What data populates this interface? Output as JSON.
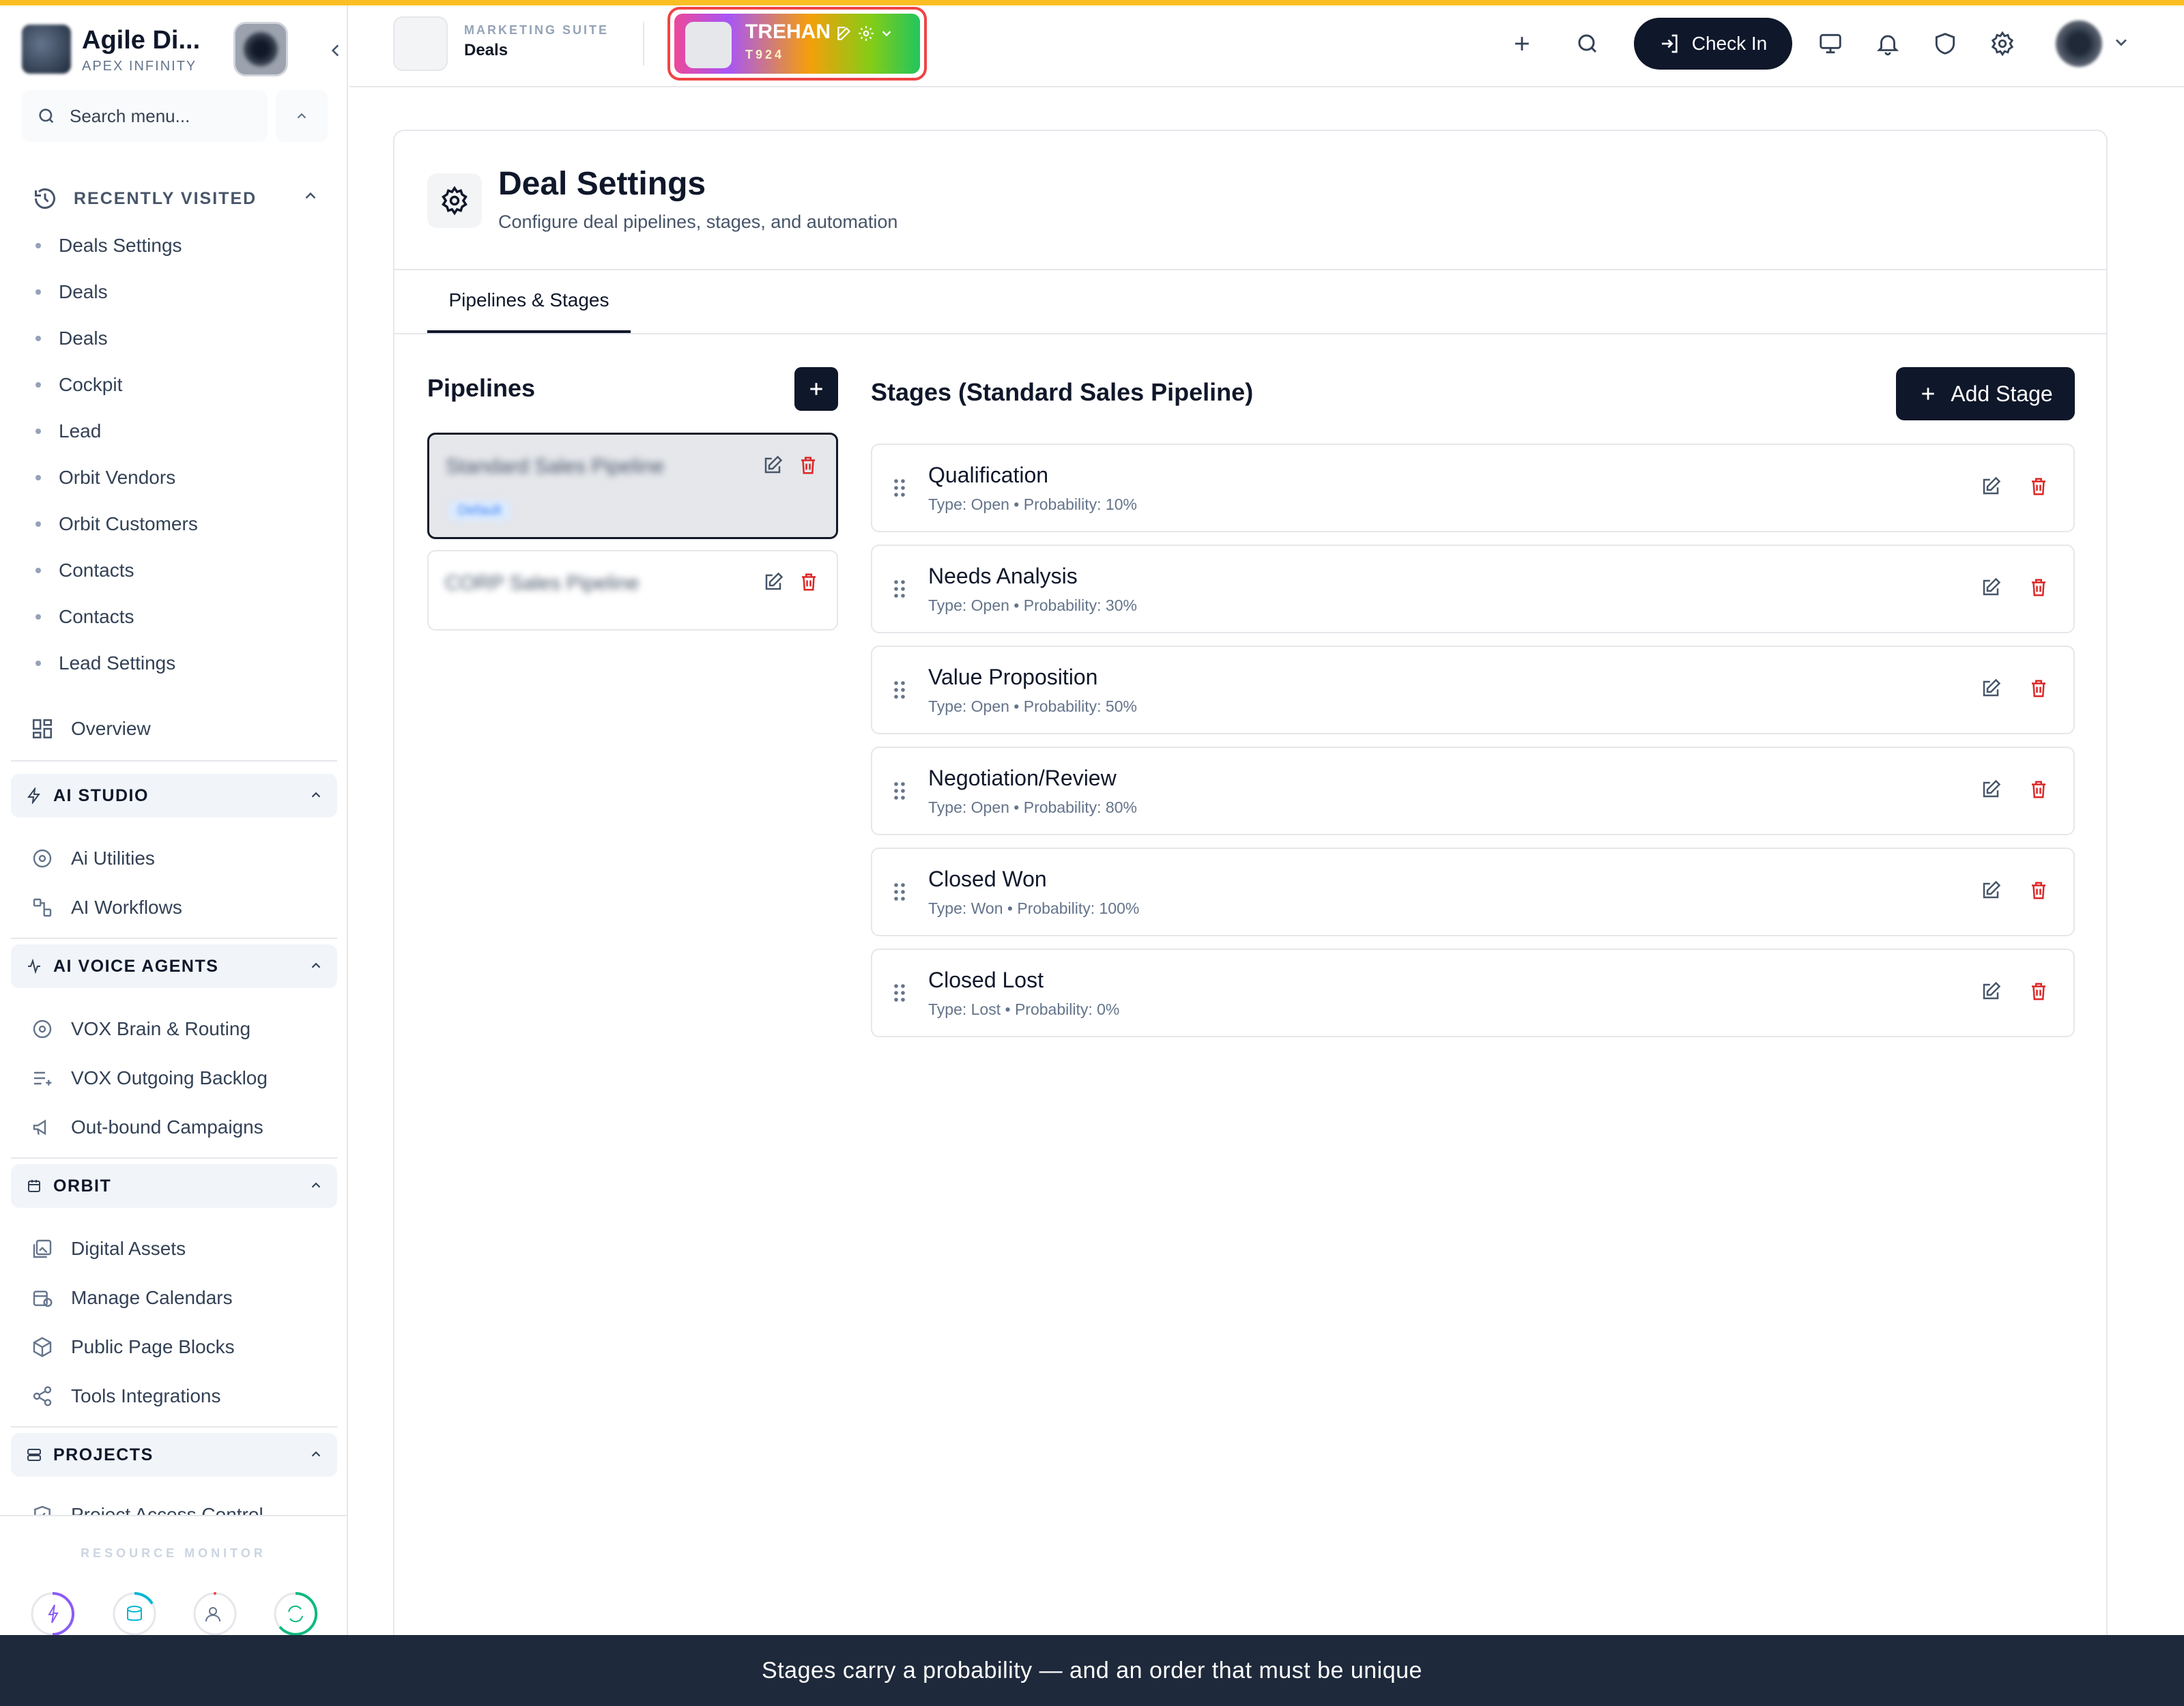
{
  "sidebar": {
    "brand_name": "Agile Di...",
    "brand_sub": "APEX INFINITY",
    "search_placeholder": "Search menu...",
    "recent_title": "RECENTLY VISITED",
    "recent": [
      "Deals Settings",
      "Deals",
      "Deals",
      "Cockpit",
      "Lead",
      "Orbit Vendors",
      "Orbit Customers",
      "Contacts",
      "Contacts",
      "Lead Settings"
    ],
    "overview_label": "Overview",
    "sections": {
      "ai_studio": {
        "title": "AI STUDIO",
        "items": [
          "Ai Utilities",
          "AI Workflows"
        ]
      },
      "ai_voice": {
        "title": "AI VOICE AGENTS",
        "items": [
          "VOX Brain & Routing",
          "VOX Outgoing Backlog",
          "Out-bound Campaigns"
        ]
      },
      "orbit": {
        "title": "ORBIT",
        "items": [
          "Digital Assets",
          "Manage Calendars",
          "Public Page Blocks",
          "Tools Integrations"
        ]
      },
      "projects": {
        "title": "PROJECTS",
        "items": [
          "Project Access Control"
        ]
      }
    },
    "resource_monitor": "RESOURCE MONITOR"
  },
  "header": {
    "app_kicker": "MARKETING SUITE",
    "app_title": "Deals",
    "tenant_name": "TREHAN",
    "tenant_code": "T924",
    "checkin_label": "Check In"
  },
  "page": {
    "title": "Deal Settings",
    "subtitle": "Configure deal pipelines, stages, and automation",
    "tab": "Pipelines & Stages",
    "pipelines_title": "Pipelines",
    "pipelines": [
      {
        "name": "Standard Sales Pipeline",
        "badge": "Default"
      },
      {
        "name": "CORP Sales Pipeline"
      }
    ],
    "stages_title": "Stages (Standard Sales Pipeline)",
    "add_stage_label": "Add Stage",
    "stages": [
      {
        "name": "Qualification",
        "meta": "Type: Open • Probability: 10%"
      },
      {
        "name": "Needs Analysis",
        "meta": "Type: Open • Probability: 30%"
      },
      {
        "name": "Value Proposition",
        "meta": "Type: Open • Probability: 50%"
      },
      {
        "name": "Negotiation/Review",
        "meta": "Type: Open • Probability: 80%"
      },
      {
        "name": "Closed Won",
        "meta": "Type: Won • Probability: 100%"
      },
      {
        "name": "Closed Lost",
        "meta": "Type: Lost • Probability: 0%"
      }
    ]
  },
  "caption": "Stages carry a probability — and an order that must be unique",
  "colors": {
    "accent": "#0f172a",
    "danger": "#dc2626",
    "stripe": "#fbbf24"
  }
}
